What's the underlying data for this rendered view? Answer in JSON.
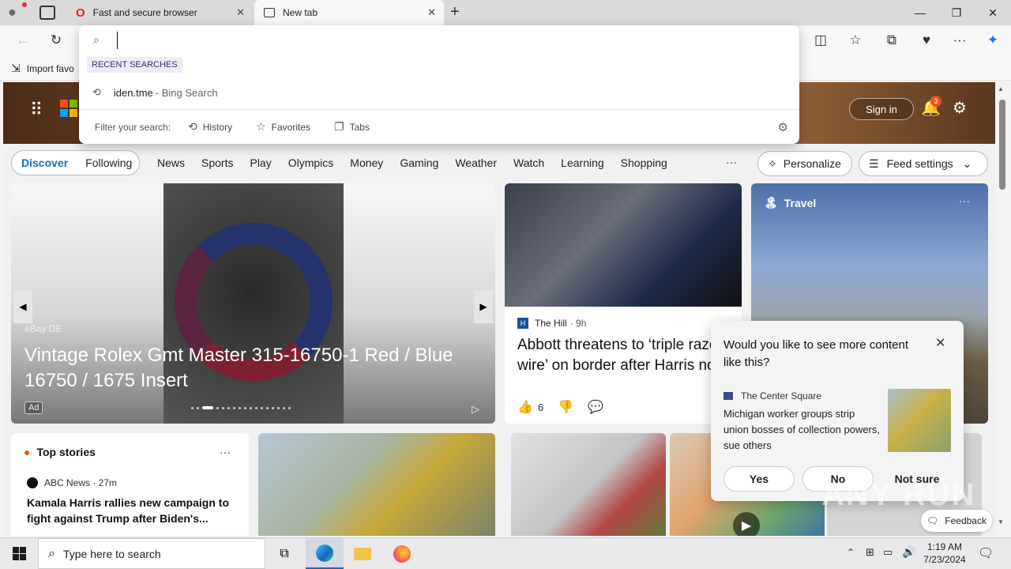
{
  "tabs": [
    {
      "label": "Fast and secure browser"
    },
    {
      "label": "New tab"
    }
  ],
  "favorites": {
    "import_label": "Import favo"
  },
  "address": {
    "value": ""
  },
  "autocomplete": {
    "section_label": "RECENT SEARCHES",
    "recent": {
      "query": "iden.tme",
      "source": " - Bing Search"
    },
    "filter_label": "Filter your search:",
    "filters": [
      "History",
      "Favorites",
      "Tabs"
    ]
  },
  "header": {
    "sign_in": "Sign in",
    "notif_count": "3"
  },
  "nav": {
    "discover": "Discover",
    "following": "Following",
    "links": [
      "News",
      "Sports",
      "Play",
      "Olympics",
      "Money",
      "Gaming",
      "Weather",
      "Watch",
      "Learning",
      "Shopping"
    ],
    "more": "···",
    "personalize": "Personalize",
    "feed_settings": "Feed settings"
  },
  "ad": {
    "source": "eBay DE",
    "title": "Vintage Rolex Gmt Master 315-16750-1 Red / Blue 16750 / 1675 Insert",
    "badge": "Ad"
  },
  "news": {
    "source": "The Hill",
    "age": "· 9h",
    "headline": "Abbott threatens to ‘triple razor wire’ on border after Harris nod",
    "likes": "6"
  },
  "travel": {
    "label": "Travel"
  },
  "popup": {
    "question": "Would you like to see more content like this?",
    "source": "The Center Square",
    "headline": "Michigan worker groups strip union bosses of collection powers, sue others",
    "yes": "Yes",
    "no": "No",
    "not_sure": "Not sure"
  },
  "top_stories": {
    "title": "Top stories",
    "source": "ABC News · 27m",
    "headline": "Kamala Harris rallies new campaign to fight against Trump after Biden's..."
  },
  "feedback": "Feedback",
  "watermark": "ANY RUN",
  "taskbar": {
    "search_placeholder": "Type here to search",
    "time": "1:19 AM",
    "date": "7/23/2024"
  }
}
